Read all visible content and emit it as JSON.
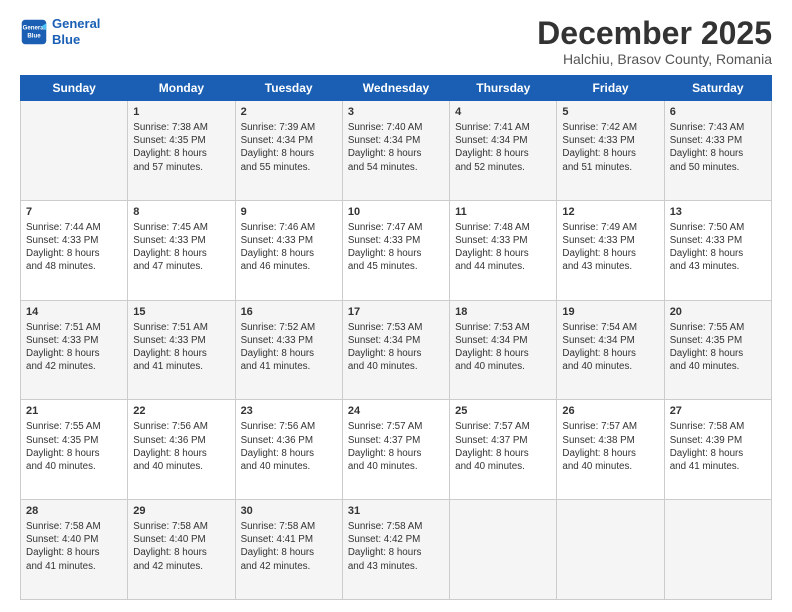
{
  "logo": {
    "line1": "General",
    "line2": "Blue"
  },
  "title": "December 2025",
  "subtitle": "Halchiu, Brasov County, Romania",
  "days_of_week": [
    "Sunday",
    "Monday",
    "Tuesday",
    "Wednesday",
    "Thursday",
    "Friday",
    "Saturday"
  ],
  "weeks": [
    [
      {
        "day": "",
        "content": ""
      },
      {
        "day": "1",
        "content": "Sunrise: 7:38 AM\nSunset: 4:35 PM\nDaylight: 8 hours\nand 57 minutes."
      },
      {
        "day": "2",
        "content": "Sunrise: 7:39 AM\nSunset: 4:34 PM\nDaylight: 8 hours\nand 55 minutes."
      },
      {
        "day": "3",
        "content": "Sunrise: 7:40 AM\nSunset: 4:34 PM\nDaylight: 8 hours\nand 54 minutes."
      },
      {
        "day": "4",
        "content": "Sunrise: 7:41 AM\nSunset: 4:34 PM\nDaylight: 8 hours\nand 52 minutes."
      },
      {
        "day": "5",
        "content": "Sunrise: 7:42 AM\nSunset: 4:33 PM\nDaylight: 8 hours\nand 51 minutes."
      },
      {
        "day": "6",
        "content": "Sunrise: 7:43 AM\nSunset: 4:33 PM\nDaylight: 8 hours\nand 50 minutes."
      }
    ],
    [
      {
        "day": "7",
        "content": "Sunrise: 7:44 AM\nSunset: 4:33 PM\nDaylight: 8 hours\nand 48 minutes."
      },
      {
        "day": "8",
        "content": "Sunrise: 7:45 AM\nSunset: 4:33 PM\nDaylight: 8 hours\nand 47 minutes."
      },
      {
        "day": "9",
        "content": "Sunrise: 7:46 AM\nSunset: 4:33 PM\nDaylight: 8 hours\nand 46 minutes."
      },
      {
        "day": "10",
        "content": "Sunrise: 7:47 AM\nSunset: 4:33 PM\nDaylight: 8 hours\nand 45 minutes."
      },
      {
        "day": "11",
        "content": "Sunrise: 7:48 AM\nSunset: 4:33 PM\nDaylight: 8 hours\nand 44 minutes."
      },
      {
        "day": "12",
        "content": "Sunrise: 7:49 AM\nSunset: 4:33 PM\nDaylight: 8 hours\nand 43 minutes."
      },
      {
        "day": "13",
        "content": "Sunrise: 7:50 AM\nSunset: 4:33 PM\nDaylight: 8 hours\nand 43 minutes."
      }
    ],
    [
      {
        "day": "14",
        "content": "Sunrise: 7:51 AM\nSunset: 4:33 PM\nDaylight: 8 hours\nand 42 minutes."
      },
      {
        "day": "15",
        "content": "Sunrise: 7:51 AM\nSunset: 4:33 PM\nDaylight: 8 hours\nand 41 minutes."
      },
      {
        "day": "16",
        "content": "Sunrise: 7:52 AM\nSunset: 4:33 PM\nDaylight: 8 hours\nand 41 minutes."
      },
      {
        "day": "17",
        "content": "Sunrise: 7:53 AM\nSunset: 4:34 PM\nDaylight: 8 hours\nand 40 minutes."
      },
      {
        "day": "18",
        "content": "Sunrise: 7:53 AM\nSunset: 4:34 PM\nDaylight: 8 hours\nand 40 minutes."
      },
      {
        "day": "19",
        "content": "Sunrise: 7:54 AM\nSunset: 4:34 PM\nDaylight: 8 hours\nand 40 minutes."
      },
      {
        "day": "20",
        "content": "Sunrise: 7:55 AM\nSunset: 4:35 PM\nDaylight: 8 hours\nand 40 minutes."
      }
    ],
    [
      {
        "day": "21",
        "content": "Sunrise: 7:55 AM\nSunset: 4:35 PM\nDaylight: 8 hours\nand 40 minutes."
      },
      {
        "day": "22",
        "content": "Sunrise: 7:56 AM\nSunset: 4:36 PM\nDaylight: 8 hours\nand 40 minutes."
      },
      {
        "day": "23",
        "content": "Sunrise: 7:56 AM\nSunset: 4:36 PM\nDaylight: 8 hours\nand 40 minutes."
      },
      {
        "day": "24",
        "content": "Sunrise: 7:57 AM\nSunset: 4:37 PM\nDaylight: 8 hours\nand 40 minutes."
      },
      {
        "day": "25",
        "content": "Sunrise: 7:57 AM\nSunset: 4:37 PM\nDaylight: 8 hours\nand 40 minutes."
      },
      {
        "day": "26",
        "content": "Sunrise: 7:57 AM\nSunset: 4:38 PM\nDaylight: 8 hours\nand 40 minutes."
      },
      {
        "day": "27",
        "content": "Sunrise: 7:58 AM\nSunset: 4:39 PM\nDaylight: 8 hours\nand 41 minutes."
      }
    ],
    [
      {
        "day": "28",
        "content": "Sunrise: 7:58 AM\nSunset: 4:40 PM\nDaylight: 8 hours\nand 41 minutes."
      },
      {
        "day": "29",
        "content": "Sunrise: 7:58 AM\nSunset: 4:40 PM\nDaylight: 8 hours\nand 42 minutes."
      },
      {
        "day": "30",
        "content": "Sunrise: 7:58 AM\nSunset: 4:41 PM\nDaylight: 8 hours\nand 42 minutes."
      },
      {
        "day": "31",
        "content": "Sunrise: 7:58 AM\nSunset: 4:42 PM\nDaylight: 8 hours\nand 43 minutes."
      },
      {
        "day": "",
        "content": ""
      },
      {
        "day": "",
        "content": ""
      },
      {
        "day": "",
        "content": ""
      }
    ]
  ]
}
